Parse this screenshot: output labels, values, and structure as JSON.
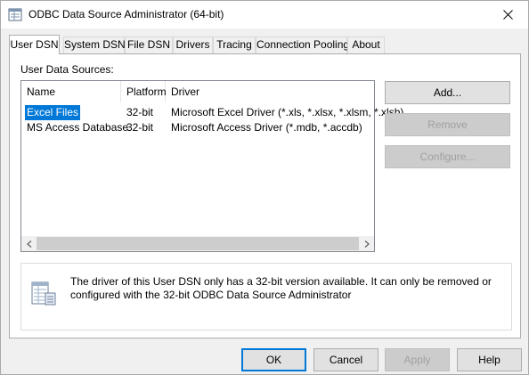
{
  "window": {
    "title": "ODBC Data Source Administrator (64-bit)",
    "close_label": "✕"
  },
  "tabs": [
    {
      "label": "User DSN",
      "active": true
    },
    {
      "label": "System DSN",
      "active": false
    },
    {
      "label": "File DSN",
      "active": false
    },
    {
      "label": "Drivers",
      "active": false
    },
    {
      "label": "Tracing",
      "active": false
    },
    {
      "label": "Connection Pooling",
      "active": false
    },
    {
      "label": "About",
      "active": false
    }
  ],
  "user_dsn": {
    "section_label": "User Data Sources:",
    "columns": [
      "Name",
      "Platform",
      "Driver"
    ],
    "rows": [
      {
        "name": "Excel Files",
        "platform": "32-bit",
        "driver": "Microsoft Excel Driver (*.xls, *.xlsx, *.xlsm, *.xlsb)",
        "selected": true
      },
      {
        "name": "MS Access Database",
        "platform": "32-bit",
        "driver": "Microsoft Access Driver (*.mdb, *.accdb)",
        "selected": false
      }
    ],
    "buttons": {
      "add": "Add...",
      "remove": "Remove",
      "configure": "Configure..."
    },
    "info_text": "The driver of this User DSN only has a 32-bit version available. It can only be removed or configured with the 32-bit ODBC Data Source Administrator"
  },
  "footer": {
    "ok": "OK",
    "cancel": "Cancel",
    "apply": "Apply",
    "help": "Help"
  },
  "colors": {
    "selection": "#0078d7",
    "disabled_text": "#a0a0a0"
  }
}
